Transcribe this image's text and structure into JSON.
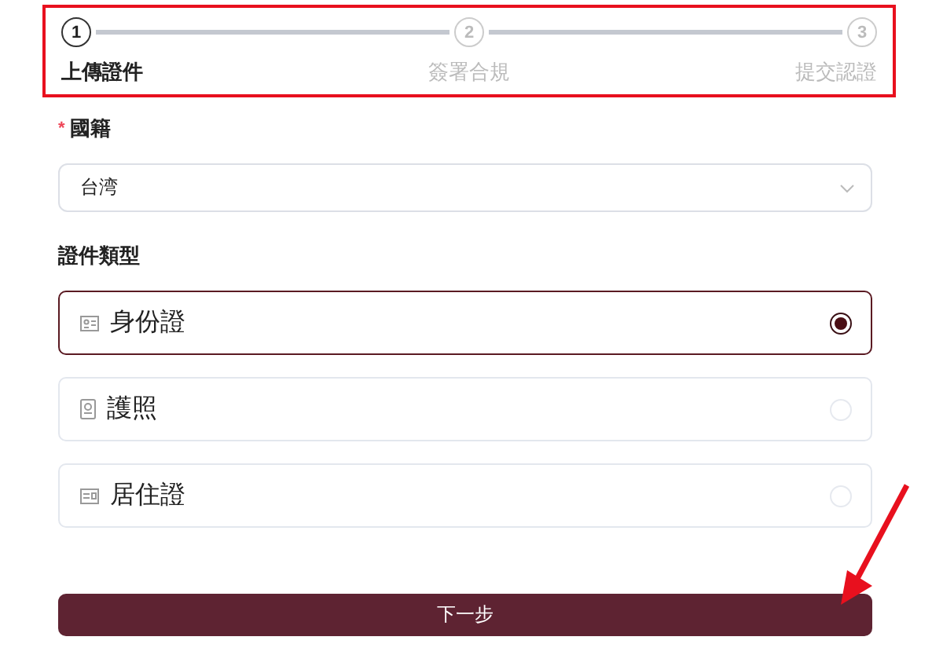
{
  "steps": [
    {
      "number": "1",
      "label": "上傳證件",
      "selected": true
    },
    {
      "number": "2",
      "label": "簽署合規",
      "selected": false
    },
    {
      "number": "3",
      "label": "提交認證",
      "selected": false
    }
  ],
  "nationality": {
    "required_mark": "*",
    "label": "國籍",
    "value": "台湾"
  },
  "document_type": {
    "label": "證件類型",
    "options": [
      {
        "label": "身份證",
        "kind": "id",
        "selected": true
      },
      {
        "label": "護照",
        "kind": "passport",
        "selected": false
      },
      {
        "label": "居住證",
        "kind": "residence",
        "selected": false
      }
    ]
  },
  "next_button": {
    "label": "下一步"
  }
}
